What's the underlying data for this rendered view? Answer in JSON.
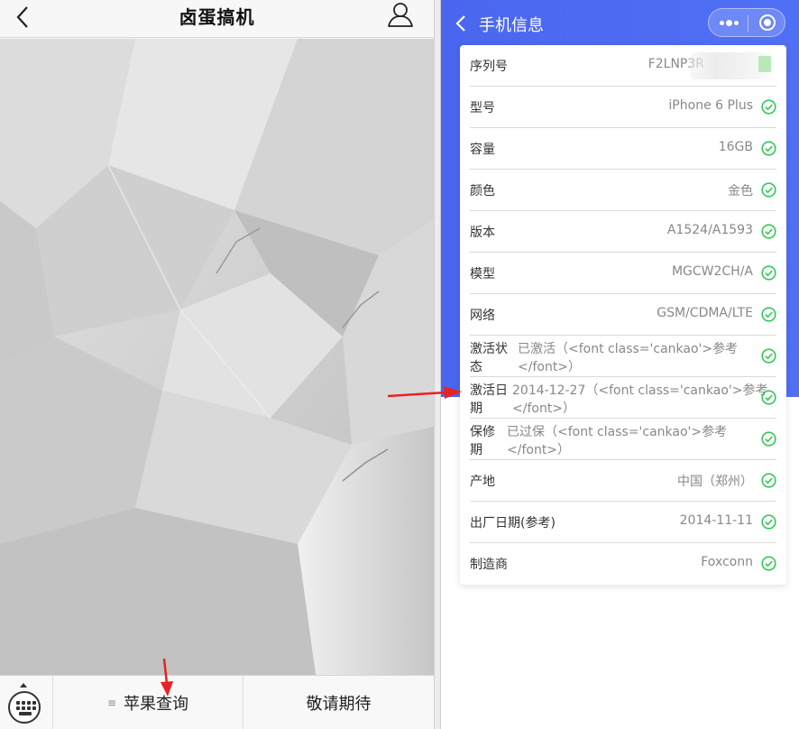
{
  "left": {
    "title": "卤蛋搞机",
    "menu": [
      {
        "label": "苹果查询"
      },
      {
        "label": "敬请期待"
      }
    ]
  },
  "right": {
    "title": "手机信息",
    "rows": [
      {
        "label": "序列号",
        "value": "F2LNP3R"
      },
      {
        "label": "型号",
        "value": "iPhone 6 Plus"
      },
      {
        "label": "容量",
        "value": "16GB"
      },
      {
        "label": "颜色",
        "value": "金色"
      },
      {
        "label": "版本",
        "value": "A1524/A1593"
      },
      {
        "label": "模型",
        "value": "MGCW2CH/A"
      },
      {
        "label": "网络",
        "value": "GSM/CDMA/LTE"
      },
      {
        "label": "激活状态",
        "value_line1": "已激活（<font class='cankao'>参考",
        "value_line2": "</font>）"
      },
      {
        "label": "激活日期",
        "value_line1": "2014-12-27（<font class='cankao'>参考",
        "value_line2": "</font>）"
      },
      {
        "label": "保修期",
        "value_line1": "已过保（<font class='cankao'>参考",
        "value_line2": "</font>）"
      },
      {
        "label": "产地",
        "value": "中国（郑州）"
      },
      {
        "label": "出厂日期(参考)",
        "value": "2014-11-11"
      },
      {
        "label": "制造商",
        "value": "Foxconn"
      }
    ]
  },
  "colors": {
    "accent_blue": "#4a66f0",
    "check_green": "#34c759",
    "arrow_red": "#e82222"
  }
}
